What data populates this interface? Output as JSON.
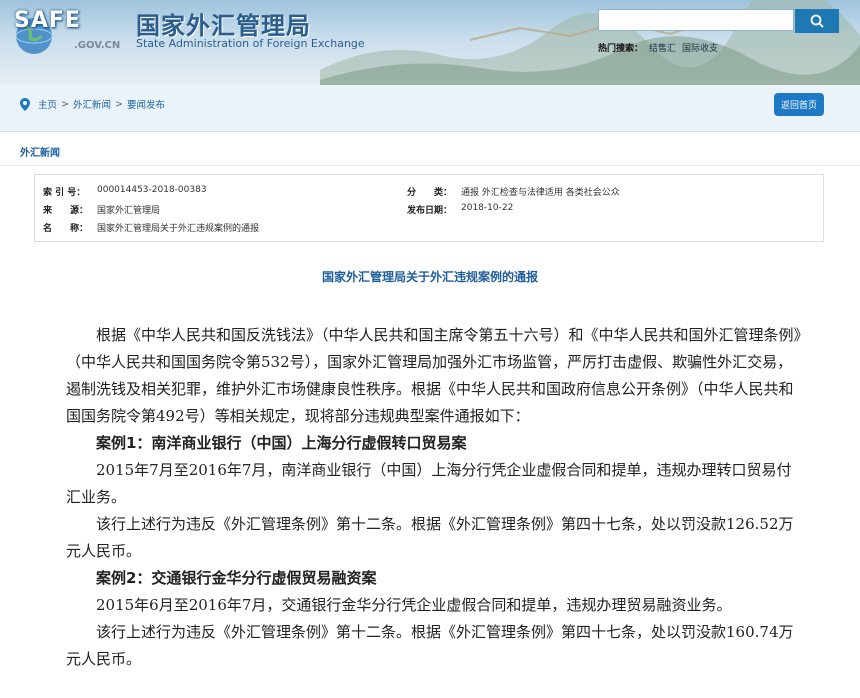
{
  "header": {
    "logo_text": "SAFE",
    "logo_domain": ".GOV.CN",
    "site_title": "国家外汇管理局",
    "site_subtitle": "State Administration of Foreign Exchange",
    "search_placeholder": "",
    "hot_search_label": "热门搜索：",
    "hot_search_items": [
      "结售汇",
      "国际收支"
    ]
  },
  "breadcrumb": {
    "items": [
      "主页",
      "外汇新闻",
      "要闻发布"
    ],
    "separator": ">"
  },
  "back_button": "返回首页",
  "section_title": "外汇新闻",
  "meta": {
    "index_label": "索 引 号：",
    "index_value": "000014453-2018-00383",
    "source_label": "来　　源：",
    "source_value": "国家外汇管理局",
    "name_label": "名　　称：",
    "name_value": "国家外汇管理局关于外汇违规案例的通报",
    "category_label": "分　　类：",
    "category_value": "通报  外汇检查与法律适用  各类社会公众",
    "date_label": "发布日期：",
    "date_value": "2018-10-22"
  },
  "article": {
    "title": "国家外汇管理局关于外汇违规案例的通报",
    "intro": "根据《中华人民共和国反洗钱法》（中华人民共和国主席令第五十六号）和《中华人民共和国外汇管理条例》（中华人民共和国国务院令第532号），国家外汇管理局加强外汇市场监管，严厉打击虚假、欺骗性外汇交易，遏制洗钱及相关犯罪，维护外汇市场健康良性秩序。根据《中华人民共和国政府信息公开条例》（中华人民共和国国务院令第492号）等相关规定，现将部分违规典型案件通报如下：",
    "case1_title": "案例1：南洋商业银行（中国）上海分行虚假转口贸易案",
    "case1_fact": "2015年7月至2016年7月，南洋商业银行（中国）上海分行凭企业虚假合同和提单，违规办理转口贸易付汇业务。",
    "case1_penalty": "该行上述行为违反《外汇管理条例》第十二条。根据《外汇管理条例》第四十七条，处以罚没款126.52万元人民币。",
    "case2_title": "案例2：交通银行金华分行虚假贸易融资案",
    "case2_fact": "2015年6月至2016年7月，交通银行金华分行凭企业虚假合同和提单，违规办理贸易融资业务。",
    "case2_penalty": "该行上述行为违反《外汇管理条例》第十二条。根据《外汇管理条例》第四十七条，处以罚没款160.74万元人民币。"
  },
  "icons": {
    "search": "search-icon",
    "location": "location-pin-icon"
  },
  "colors": {
    "brand_blue": "#1e78b4",
    "link_blue": "#1d62a3",
    "title_blue": "#1f5f9e"
  }
}
